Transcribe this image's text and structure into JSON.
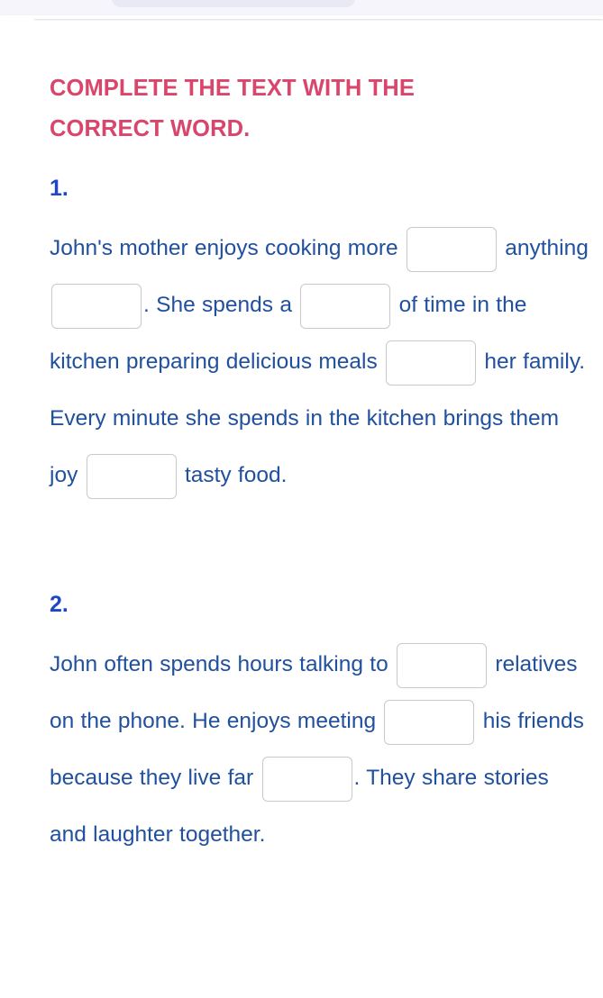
{
  "header": {
    "band_color": "#f5f5fb",
    "pill_label": ""
  },
  "colors": {
    "title": "#d9456b",
    "question_number": "#1e46c8",
    "body_text": "#20509e",
    "blank_border": "#c9c9c9",
    "page_background": "#ffffff"
  },
  "exercise": {
    "title": "COMPLETE THE TEXT WITH THE CORRECT WORD."
  },
  "questions": [
    {
      "number": "1.",
      "segments": [
        {
          "type": "text",
          "value": "John's mother enjoys cooking more "
        },
        {
          "type": "blank",
          "value": "",
          "placeholder": ""
        },
        {
          "type": "text",
          "value": " anything "
        },
        {
          "type": "blank",
          "value": "",
          "placeholder": ""
        },
        {
          "type": "text",
          "value": ". She spends a "
        },
        {
          "type": "blank",
          "value": "",
          "placeholder": ""
        },
        {
          "type": "text",
          "value": " of time in the kitchen preparing delicious meals "
        },
        {
          "type": "blank",
          "value": "",
          "placeholder": ""
        },
        {
          "type": "text",
          "value": " her family. Every minute she spends in the kitchen brings them joy "
        },
        {
          "type": "blank",
          "value": "",
          "placeholder": ""
        },
        {
          "type": "text",
          "value": " tasty food."
        }
      ]
    },
    {
      "number": "2.",
      "segments": [
        {
          "type": "text",
          "value": "John often spends hours talking to "
        },
        {
          "type": "blank",
          "value": "",
          "placeholder": ""
        },
        {
          "type": "text",
          "value": " relatives on the phone. He enjoys meeting "
        },
        {
          "type": "blank",
          "value": "",
          "placeholder": ""
        },
        {
          "type": "text",
          "value": " his friends because they live far "
        },
        {
          "type": "blank",
          "value": "",
          "placeholder": ""
        },
        {
          "type": "text",
          "value": ". They share stories and laughter together."
        }
      ]
    }
  ]
}
